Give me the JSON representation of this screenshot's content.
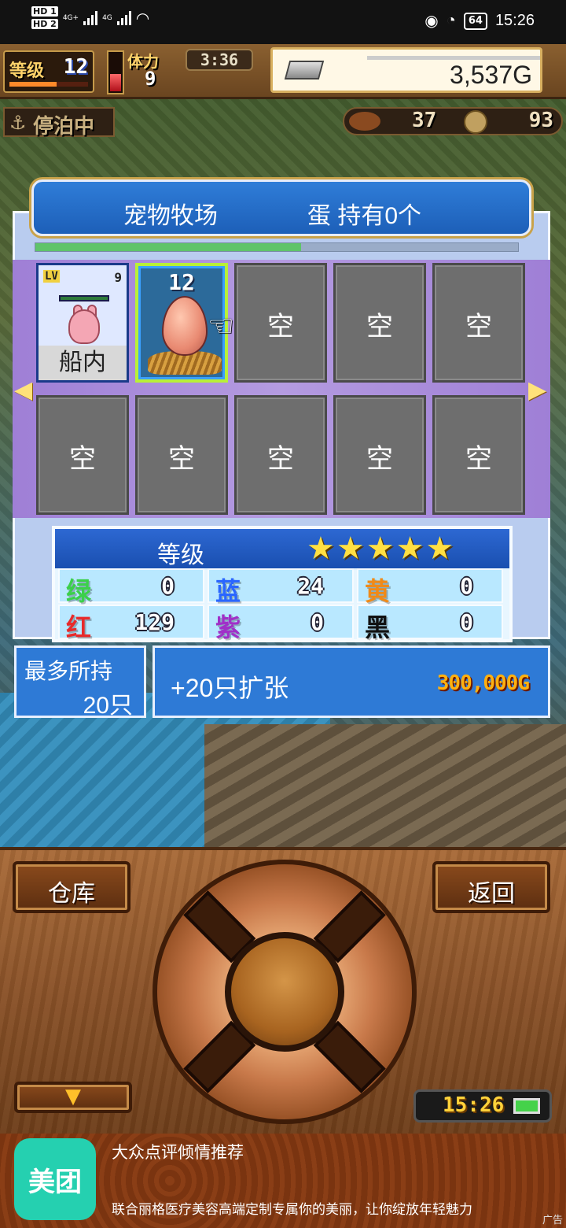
{
  "status_bar": {
    "hd1": "HD 1",
    "hd2": "HD 2",
    "net1": "4G+",
    "net2": "4G",
    "battery": "64",
    "time": "15:26"
  },
  "hud": {
    "level_label": "等级",
    "level_value": "12",
    "level_progress": 0.6,
    "stamina_label": "体力",
    "stamina_value": "9",
    "stamina_fill": 0.45,
    "timer": "3:36",
    "gold": "3,537G",
    "anchor_icon": "⚓",
    "anchor_status": "停泊中",
    "resource_a": "37",
    "resource_b": "93"
  },
  "ranch": {
    "title": "宠物牧场",
    "egg_status": "蛋 持有0个",
    "progress": 0.55,
    "slots": [
      {
        "type": "pet",
        "lv_label": "LV",
        "lv_value": "9",
        "label": "船内"
      },
      {
        "type": "egg",
        "count": "12"
      },
      {
        "type": "empty",
        "label": "空"
      },
      {
        "type": "empty",
        "label": "空"
      },
      {
        "type": "empty",
        "label": "空"
      },
      {
        "type": "empty",
        "label": "空"
      },
      {
        "type": "empty",
        "label": "空"
      },
      {
        "type": "empty",
        "label": "空"
      },
      {
        "type": "empty",
        "label": "空"
      },
      {
        "type": "empty",
        "label": "空"
      }
    ]
  },
  "grade": {
    "title": "等级",
    "stars": "★★★★★",
    "star_count": 5,
    "colors": [
      {
        "key": "绿",
        "value": "0",
        "color": "#3bd04a"
      },
      {
        "key": "蓝",
        "value": "24",
        "color": "#2a66ff"
      },
      {
        "key": "黄",
        "value": "0",
        "color": "#f08a18"
      },
      {
        "key": "红",
        "value": "129",
        "color": "#e82a2a"
      },
      {
        "key": "紫",
        "value": "0",
        "color": "#a030c8"
      },
      {
        "key": "黑",
        "value": "0",
        "color": "#111111"
      }
    ]
  },
  "capacity": {
    "label": "最多所持",
    "value": "20只",
    "expand_label": "+20只扩张",
    "expand_price": "300,000G"
  },
  "controls": {
    "warehouse": "仓库",
    "back": "返回",
    "down_icon": "▼",
    "clock": "15:26"
  },
  "ad": {
    "logo": "美团",
    "title": "大众点评倾情推荐",
    "desc": "联合丽格医疗美容高端定制专属你的美丽，让你绽放年轻魅力",
    "tag": "广告"
  }
}
